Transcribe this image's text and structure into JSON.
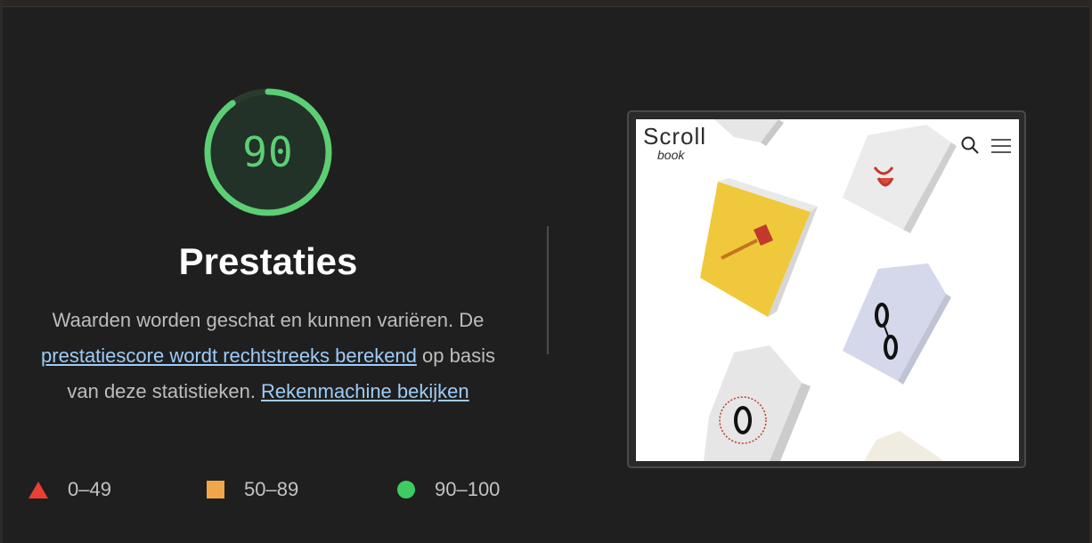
{
  "score": {
    "value": "90",
    "fraction": 0.9,
    "color": "#5ccf74"
  },
  "title": "Prestaties",
  "description": {
    "text1": "Waarden worden geschat en kunnen variëren. De ",
    "link1": "prestatiescore wordt rechtstreeks berekend",
    "text2": " op basis van deze statistieken. ",
    "link2": "Rekenmachine bekijken"
  },
  "legend": [
    {
      "range": "0–49",
      "shape": "triangle",
      "color": "#ea3f33"
    },
    {
      "range": "50–89",
      "shape": "square",
      "color": "#f2a64b"
    },
    {
      "range": "90–100",
      "shape": "circle",
      "color": "#3ecb62"
    }
  ],
  "screenshot": {
    "logo_top": "Scroll",
    "logo_bottom": "book",
    "icons": [
      "search-icon",
      "hamburger-menu-icon"
    ]
  }
}
